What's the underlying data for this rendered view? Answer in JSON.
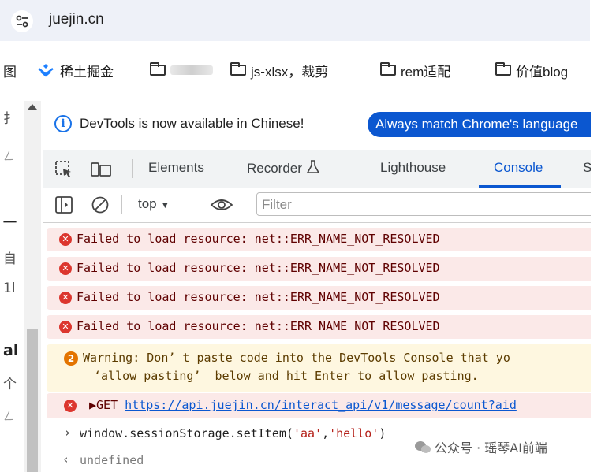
{
  "address_bar": {
    "url": "juejin.cn"
  },
  "bookmarks": [
    {
      "label": "图",
      "icon": "cut-off"
    },
    {
      "label": "稀土掘金",
      "icon": "juejin-logo-icon"
    },
    {
      "label": "",
      "icon": "folder-icon"
    },
    {
      "label": "js-xlsx，裁剪",
      "icon": "folder-icon"
    },
    {
      "label": "rem适配",
      "icon": "folder-icon"
    },
    {
      "label": "价值blog",
      "icon": "folder-icon"
    }
  ],
  "left_page": {
    "fragments": [
      "扌",
      "ㄥ",
      "一",
      "自",
      "1l",
      "al",
      "个",
      "ㄥ"
    ]
  },
  "devtools": {
    "info_bar": {
      "message": "DevTools is now available in Chinese!",
      "button": "Always match Chrome's language"
    },
    "tabs": [
      "Elements",
      "Recorder",
      "Lighthouse",
      "Console",
      "S"
    ],
    "active_tab": "Console",
    "console_toolbar": {
      "context": "top",
      "filter_placeholder": "Filter"
    },
    "messages": {
      "errors": [
        "Failed to load resource: net::ERR_NAME_NOT_RESOLVED",
        "Failed to load resource: net::ERR_NAME_NOT_RESOLVED",
        "Failed to load resource: net::ERR_NAME_NOT_RESOLVED",
        "Failed to load resource: net::ERR_NAME_NOT_RESOLVED"
      ],
      "warning": {
        "count": "2",
        "line1": "Warning: Don’ t paste code into the DevTools Console that yo",
        "line2": "‘allow pasting’  below and hit Enter to allow pasting."
      },
      "get_request": {
        "prefix": "▶GET ",
        "url": "https://api.juejin.cn/interact_api/v1/message/count?aid"
      },
      "input": {
        "code_start": "window.sessionStorage.setItem(",
        "arg1": "'aa'",
        "comma": ",",
        "arg2": "'hello'",
        "code_end": ")"
      },
      "result": "undefined"
    }
  },
  "watermark": "公众号 · 瑶琴AI前端",
  "colors": {
    "accent": "#0b57d0",
    "error": "#dc362e",
    "warning": "#e37400"
  }
}
